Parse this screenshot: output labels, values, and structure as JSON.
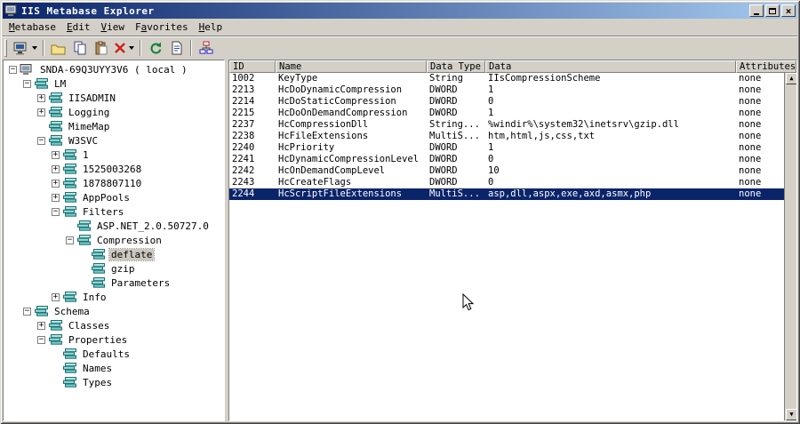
{
  "window": {
    "title": "IIS Metabase Explorer"
  },
  "menu": {
    "items": [
      "&Metabase",
      "&Edit",
      "&View",
      "F&avorites",
      "&Help"
    ]
  },
  "toolbar": {
    "buttons": [
      {
        "name": "connect",
        "icon": "computer-icon",
        "dropdown": true
      },
      {
        "sep": true
      },
      {
        "name": "new-key",
        "icon": "new-key-icon"
      },
      {
        "name": "copy",
        "icon": "copy-icon"
      },
      {
        "name": "paste",
        "icon": "paste-icon"
      },
      {
        "name": "delete",
        "icon": "delete-icon",
        "dropdown": true
      },
      {
        "sep": true
      },
      {
        "name": "refresh",
        "icon": "refresh-icon"
      },
      {
        "name": "record",
        "icon": "page-icon"
      },
      {
        "sep": true
      },
      {
        "name": "hierarchy",
        "icon": "hierarchy-icon"
      }
    ]
  },
  "tree": {
    "items": [
      {
        "depth": 0,
        "toggle": "minus",
        "icon": "computer",
        "label": "SNDA-69Q3UYY3V6 ( local )"
      },
      {
        "depth": 1,
        "toggle": "minus",
        "icon": "key",
        "label": "LM"
      },
      {
        "depth": 2,
        "toggle": "plus",
        "icon": "key",
        "label": "IISADMIN"
      },
      {
        "depth": 2,
        "toggle": "plus",
        "icon": "key",
        "label": "Logging"
      },
      {
        "depth": 2,
        "toggle": null,
        "icon": "key",
        "label": "MimeMap"
      },
      {
        "depth": 2,
        "toggle": "minus",
        "icon": "key",
        "label": "W3SVC"
      },
      {
        "depth": 3,
        "toggle": "plus",
        "icon": "key",
        "label": "1"
      },
      {
        "depth": 3,
        "toggle": "plus",
        "icon": "key",
        "label": "1525003268"
      },
      {
        "depth": 3,
        "toggle": "plus",
        "icon": "key",
        "label": "1878807110"
      },
      {
        "depth": 3,
        "toggle": "plus",
        "icon": "key",
        "label": "AppPools"
      },
      {
        "depth": 3,
        "toggle": "minus",
        "icon": "key",
        "label": "Filters"
      },
      {
        "depth": 4,
        "toggle": null,
        "icon": "key",
        "label": "ASP.NET_2.0.50727.0"
      },
      {
        "depth": 4,
        "toggle": "minus",
        "icon": "key",
        "label": "Compression"
      },
      {
        "depth": 5,
        "toggle": null,
        "icon": "key",
        "label": "deflate",
        "selected": true
      },
      {
        "depth": 5,
        "toggle": null,
        "icon": "key",
        "label": "gzip"
      },
      {
        "depth": 5,
        "toggle": null,
        "icon": "key",
        "label": "Parameters"
      },
      {
        "depth": 3,
        "toggle": "plus",
        "icon": "key",
        "label": "Info"
      },
      {
        "depth": 1,
        "toggle": "minus",
        "icon": "key",
        "label": "Schema"
      },
      {
        "depth": 2,
        "toggle": "plus",
        "icon": "key",
        "label": "Classes"
      },
      {
        "depth": 2,
        "toggle": "minus",
        "icon": "key",
        "label": "Properties"
      },
      {
        "depth": 3,
        "toggle": null,
        "icon": "key",
        "label": "Defaults"
      },
      {
        "depth": 3,
        "toggle": null,
        "icon": "key",
        "label": "Names"
      },
      {
        "depth": 3,
        "toggle": null,
        "icon": "key",
        "label": "Types"
      }
    ]
  },
  "table": {
    "columns": [
      "ID",
      "Name",
      "Data Type",
      "Data",
      "Attributes"
    ],
    "rows": [
      {
        "cells": [
          "1002",
          "KeyType",
          "String",
          "IIsCompressionScheme",
          "none"
        ]
      },
      {
        "cells": [
          "2213",
          "HcDoDynamicCompression",
          "DWORD",
          "1",
          "none"
        ]
      },
      {
        "cells": [
          "2214",
          "HcDoStaticCompression",
          "DWORD",
          "0",
          "none"
        ]
      },
      {
        "cells": [
          "2215",
          "HcDoOnDemandCompression",
          "DWORD",
          "1",
          "none"
        ]
      },
      {
        "cells": [
          "2237",
          "HcCompressionDll",
          "String...",
          "%windir%\\system32\\inetsrv\\gzip.dll",
          "none"
        ]
      },
      {
        "cells": [
          "2238",
          "HcFileExtensions",
          "MultiS...",
          "htm,html,js,css,txt",
          "none"
        ]
      },
      {
        "cells": [
          "2240",
          "HcPriority",
          "DWORD",
          "1",
          "none"
        ]
      },
      {
        "cells": [
          "2241",
          "HcDynamicCompressionLevel",
          "DWORD",
          "0",
          "none"
        ]
      },
      {
        "cells": [
          "2242",
          "HcOnDemandCompLevel",
          "DWORD",
          "10",
          "none"
        ]
      },
      {
        "cells": [
          "2243",
          "HcCreateFlags",
          "DWORD",
          "0",
          "none"
        ]
      },
      {
        "cells": [
          "2244",
          "HcScriptFileExtensions",
          "MultiS...",
          "asp,dll,aspx,exe,axd,asmx,php",
          "none"
        ],
        "selected": true
      }
    ]
  },
  "scrollbar": {
    "up": "▲",
    "down": "▼"
  },
  "colors": {
    "titlebar_start": "#0a246a",
    "titlebar_end": "#a6caf0",
    "chrome": "#d4d0c8",
    "selection": "#0a246a",
    "key_icon": "#8fd8d8"
  }
}
